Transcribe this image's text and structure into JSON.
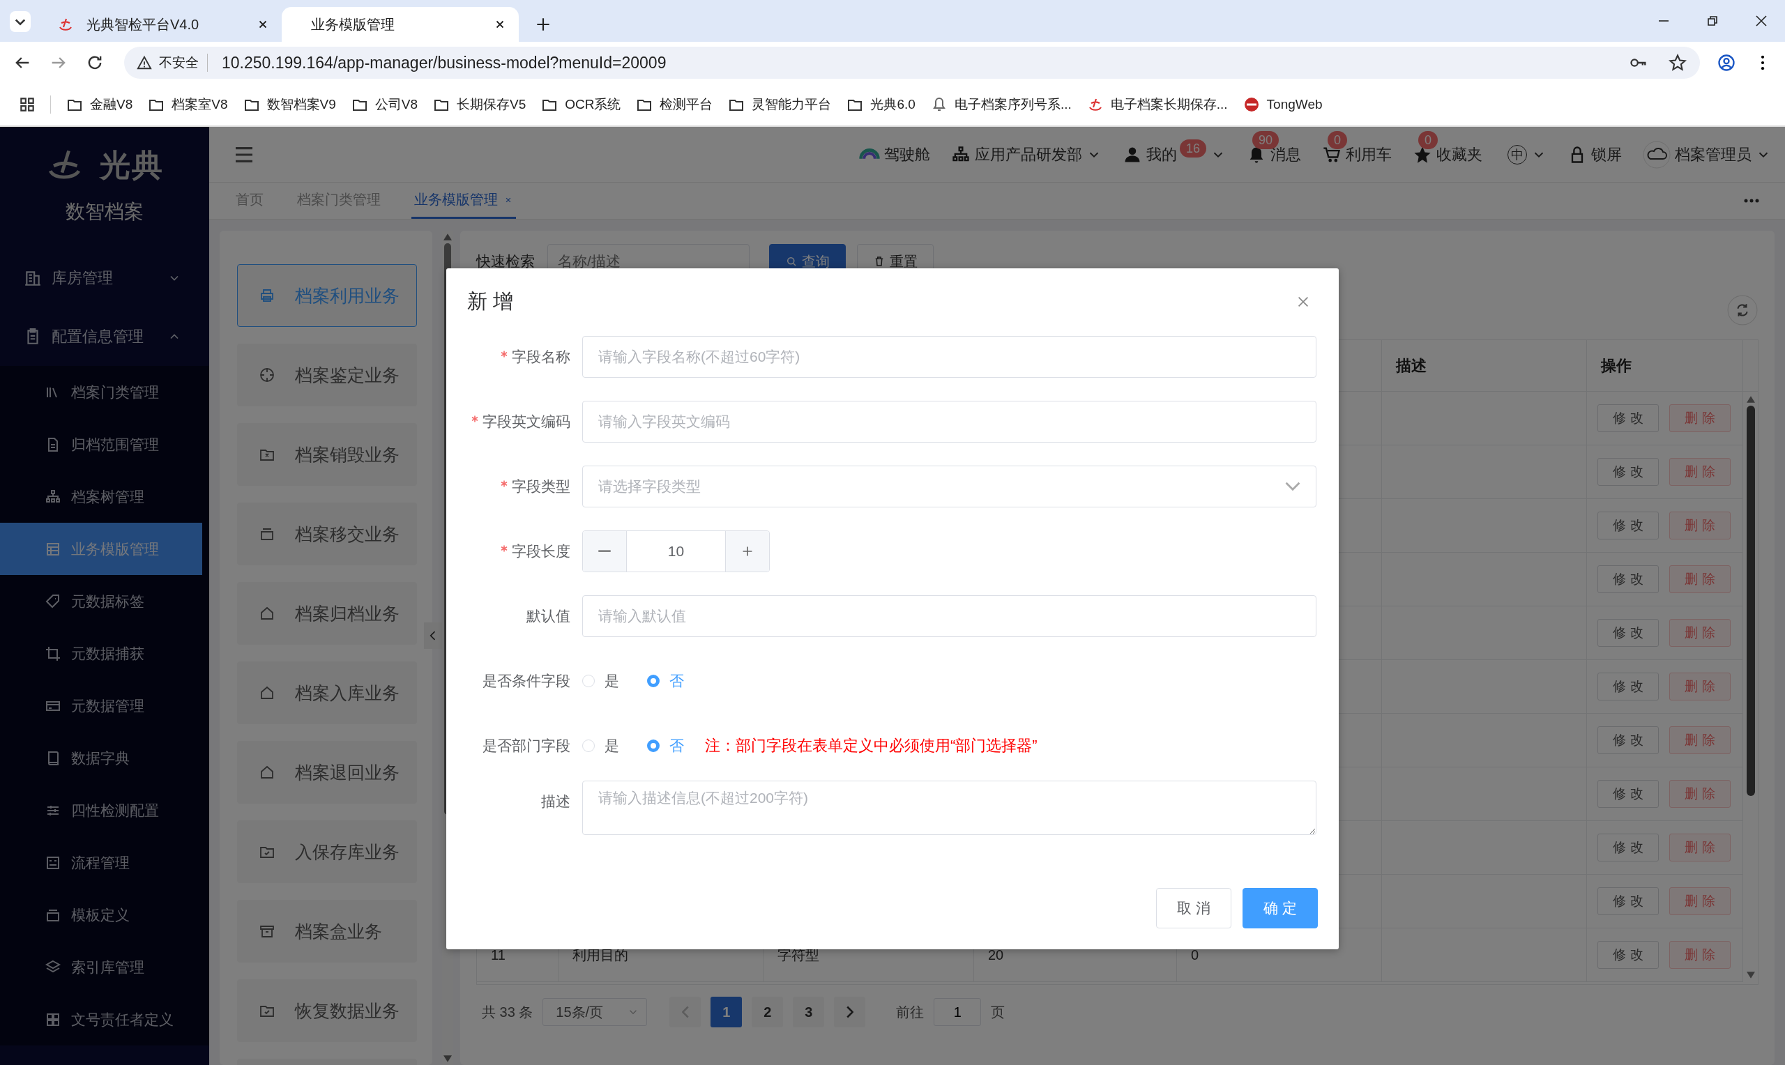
{
  "browser": {
    "tabs": [
      {
        "title": "光典智检平台V4.0",
        "selected": false
      },
      {
        "title": "业务模版管理",
        "selected": true
      }
    ],
    "address": {
      "security": "不安全",
      "url": "10.250.199.164/app-manager/business-model?menuId=20009"
    },
    "bookmarks": [
      {
        "label": "金融V8",
        "kind": "folder"
      },
      {
        "label": "档案室V8",
        "kind": "folder"
      },
      {
        "label": "数智档案V9",
        "kind": "folder"
      },
      {
        "label": "公司V8",
        "kind": "folder"
      },
      {
        "label": "长期保存V5",
        "kind": "folder"
      },
      {
        "label": "OCR系统",
        "kind": "folder"
      },
      {
        "label": "检测平台",
        "kind": "folder"
      },
      {
        "label": "灵智能力平台",
        "kind": "folder"
      },
      {
        "label": "光典6.0",
        "kind": "folder"
      },
      {
        "label": "电子档案序列号系...",
        "kind": "bell"
      },
      {
        "label": "电子档案长期保存...",
        "kind": "logo"
      },
      {
        "label": "TongWeb",
        "kind": "web"
      }
    ]
  },
  "sidebar": {
    "logo": "光典",
    "subtitle": "数智档案",
    "groups": [
      {
        "label": "库房管理",
        "kind": "building",
        "expanded": false
      },
      {
        "label": "配置信息管理",
        "kind": "clipboard",
        "expanded": true,
        "children": [
          {
            "label": "档案门类管理",
            "kind": "books",
            "selected": false
          },
          {
            "label": "归档范围管理",
            "kind": "document",
            "selected": false
          },
          {
            "label": "档案树管理",
            "kind": "hierarchy",
            "selected": false
          },
          {
            "label": "业务模版管理",
            "kind": "table",
            "selected": true
          },
          {
            "label": "元数据标签",
            "kind": "tag",
            "selected": false
          },
          {
            "label": "元数据捕获",
            "kind": "crop",
            "selected": false
          },
          {
            "label": "元数据管理",
            "kind": "card",
            "selected": false
          },
          {
            "label": "数据字典",
            "kind": "book",
            "selected": false
          },
          {
            "label": "四性检测配置",
            "kind": "sliders",
            "selected": false
          },
          {
            "label": "流程管理",
            "kind": "flow",
            "selected": false
          },
          {
            "label": "模板定义",
            "kind": "tray",
            "selected": false
          },
          {
            "label": "索引库管理",
            "kind": "layers",
            "selected": false
          },
          {
            "label": "文号责任者定义",
            "kind": "grid",
            "selected": false
          }
        ]
      }
    ]
  },
  "header": {
    "items": [
      {
        "kind": "dashboard",
        "label": "驾驶舱"
      },
      {
        "kind": "org",
        "label": "应用产品研发部",
        "dropdown": true
      },
      {
        "kind": "user",
        "label": "我的",
        "badge": "16",
        "dropdown": true
      },
      {
        "kind": "bell",
        "label": "消息",
        "badge": "90"
      },
      {
        "kind": "cart",
        "label": "利用车",
        "badge": "0"
      },
      {
        "kind": "star",
        "label": "收藏夹",
        "badge": "0"
      },
      {
        "kind": "lang",
        "label": "中",
        "dropdown": true
      },
      {
        "kind": "lock",
        "label": "锁屏"
      },
      {
        "kind": "avatar",
        "label": "档案管理员",
        "dropdown": true
      }
    ]
  },
  "page_tabs": [
    {
      "label": "首页",
      "selected": false
    },
    {
      "label": "档案门类管理",
      "selected": false
    },
    {
      "label": "业务模版管理",
      "selected": true
    }
  ],
  "business_list": [
    {
      "label": "档案利用业务",
      "kind": "printer",
      "selected": true
    },
    {
      "label": "档案鉴定业务",
      "kind": "crosshair",
      "selected": false
    },
    {
      "label": "档案销毁业务",
      "kind": "folder-x",
      "selected": false
    },
    {
      "label": "档案移交业务",
      "kind": "tray",
      "selected": false
    },
    {
      "label": "档案归档业务",
      "kind": "house",
      "selected": false
    },
    {
      "label": "档案入库业务",
      "kind": "house",
      "selected": false
    },
    {
      "label": "档案退回业务",
      "kind": "house",
      "selected": false
    },
    {
      "label": "入保存库业务",
      "kind": "folder-check",
      "selected": false
    },
    {
      "label": "档案盒业务",
      "kind": "archive-box",
      "selected": false
    },
    {
      "label": "恢复数据业务",
      "kind": "folder-check",
      "selected": false
    }
  ],
  "search": {
    "label": "快速检索",
    "placeholder": "名称/描述",
    "buttons": [
      "查询",
      "重置"
    ]
  },
  "table": {
    "columns": [
      "描述",
      "操作"
    ],
    "rows": [
      {
        "actions": [
          "修 改",
          "删 除"
        ]
      },
      {
        "actions": [
          "修 改",
          "删 除"
        ]
      },
      {
        "actions": [
          "修 改",
          "删 除"
        ]
      },
      {
        "actions": [
          "修 改",
          "删 除"
        ]
      },
      {
        "actions": [
          "修 改",
          "删 除"
        ]
      },
      {
        "actions": [
          "修 改",
          "删 除"
        ]
      },
      {
        "actions": [
          "修 改",
          "删 除"
        ]
      },
      {
        "actions": [
          "修 改",
          "删 除"
        ]
      },
      {
        "actions": [
          "修 改",
          "删 除"
        ]
      },
      {
        "actions": [
          "修 改",
          "删 除"
        ]
      },
      {
        "cells": [
          "11",
          "利用目的",
          "字符型",
          "20",
          "0"
        ],
        "actions": [
          "修 改",
          "删 除"
        ]
      }
    ]
  },
  "pagination": {
    "total": "共 33 条",
    "page_size": "15条/页",
    "pages": [
      {
        "label": "1",
        "selected": true
      },
      {
        "label": "2",
        "selected": false
      },
      {
        "label": "3",
        "selected": false
      }
    ],
    "goto": "前往",
    "goto_value": "1",
    "goto_suffix": "页"
  },
  "dialog": {
    "title": "新 增",
    "fields": [
      {
        "kind": "text",
        "label": "字段名称",
        "required": true,
        "placeholder": "请输入字段名称(不超过60字符)"
      },
      {
        "kind": "text",
        "label": "字段英文编码",
        "required": true,
        "placeholder": "请输入字段英文编码"
      },
      {
        "kind": "select",
        "label": "字段类型",
        "required": true,
        "placeholder": "请选择字段类型"
      },
      {
        "kind": "number",
        "label": "字段长度",
        "required": true,
        "value": "10"
      },
      {
        "kind": "text",
        "label": "默认值",
        "required": false,
        "placeholder": "请输入默认值"
      },
      {
        "kind": "radio",
        "label": "是否条件字段",
        "required": false,
        "options": [
          {
            "label": "是",
            "selected": false
          },
          {
            "label": "否",
            "selected": true
          }
        ]
      },
      {
        "kind": "radio",
        "label": "是否部门字段",
        "required": false,
        "options": [
          {
            "label": "是",
            "selected": false
          },
          {
            "label": "否",
            "selected": true
          }
        ],
        "note": "注：部门字段在表单定义中必须使用“部门选择器”"
      },
      {
        "kind": "textarea",
        "label": "描述",
        "required": false,
        "placeholder": "请输入描述信息(不超过200字符)"
      }
    ],
    "buttons": [
      {
        "label": "取 消",
        "kind": "default"
      },
      {
        "label": "确 定",
        "kind": "primary"
      }
    ]
  }
}
